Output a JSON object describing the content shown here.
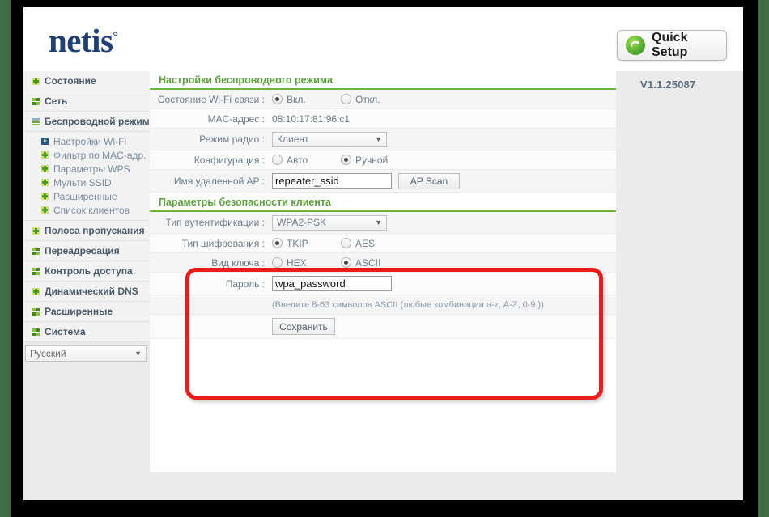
{
  "brand": {
    "logo_text": "netis",
    "logo_mark": "°"
  },
  "header": {
    "quick_setup_label": "Quick Setup",
    "quick_setup_icon": "refresh-circle-icon",
    "version": "V1.1.25087"
  },
  "sidebar": {
    "items": [
      {
        "label": "Состояние",
        "icon": "plus-square-icon",
        "level": "top",
        "active": false
      },
      {
        "label": "Сеть",
        "icon": "grid-square-icon",
        "level": "top",
        "active": false
      },
      {
        "label": "Беспроводной режим",
        "icon": "bars-square-icon",
        "level": "top",
        "active": true
      },
      {
        "label": "Настройки Wi-Fi",
        "icon": "arrow-square-icon",
        "level": "sub",
        "active": true
      },
      {
        "label": "Фильтр по MAC-адр.",
        "icon": "plus-square-icon",
        "level": "sub",
        "active": false
      },
      {
        "label": "Параметры WPS",
        "icon": "plus-square-icon",
        "level": "sub",
        "active": false
      },
      {
        "label": "Мульти SSID",
        "icon": "plus-square-icon",
        "level": "sub",
        "active": false
      },
      {
        "label": "Расширенные",
        "icon": "plus-square-icon",
        "level": "sub",
        "active": false
      },
      {
        "label": "Список клиентов",
        "icon": "plus-square-icon",
        "level": "sub",
        "active": false
      },
      {
        "label": "Полоса пропускания",
        "icon": "plus-square-icon",
        "level": "top",
        "active": false
      },
      {
        "label": "Переадресация",
        "icon": "grid-square-icon",
        "level": "top",
        "active": false
      },
      {
        "label": "Контроль доступа",
        "icon": "grid-square-icon",
        "level": "top",
        "active": false
      },
      {
        "label": "Динамический DNS",
        "icon": "plus-square-icon",
        "level": "top",
        "active": false
      },
      {
        "label": "Расширенные",
        "icon": "grid-square-icon",
        "level": "top",
        "active": false
      },
      {
        "label": "Система",
        "icon": "grid-square-icon",
        "level": "top",
        "active": false
      }
    ],
    "language_select": {
      "value": "Русский",
      "arrow": "▼"
    }
  },
  "wireless_section": {
    "title": "Настройки беспроводного режима",
    "wifi_state": {
      "label": "Состояние Wi-Fi связи :",
      "option_on": "Вкл.",
      "option_off": "Откл.",
      "selected": "on"
    },
    "mac_address": {
      "label": "MAC-адрес :",
      "value": "08:10:17:81:96:c1"
    },
    "radio_mode": {
      "label": "Режим радио :",
      "value": "Клиент",
      "arrow": "▼"
    },
    "configuration": {
      "label": "Конфигурация :",
      "option_auto": "Авто",
      "option_manual": "Ручной",
      "selected": "manual"
    },
    "remote_ap": {
      "label": "Имя удаленной AP :",
      "value": "repeater_ssid",
      "placeholder": "",
      "scan_button": "AP Scan"
    }
  },
  "security_section": {
    "title": "Параметры безопасности клиента",
    "auth_type": {
      "label": "Тип аутентификации :",
      "value": "WPA2-PSK",
      "arrow": "▼"
    },
    "encryption_type": {
      "label": "Тип шифрования :",
      "option_tkip": "TKIP",
      "option_aes": "AES",
      "selected": "tkip"
    },
    "key_type": {
      "label": "Вид ключа :",
      "option_hex": "HEX",
      "option_ascii": "ASCII",
      "selected": "ascii"
    },
    "password": {
      "label": "Пароль :",
      "value": "wpa_password",
      "placeholder": ""
    },
    "hint": "(Введите 8-63 символов ASCII (любые комбинации a-z, A-Z, 0-9.))",
    "save_button": "Сохранить"
  },
  "annotation": {
    "highlight_color": "#ed1c1c",
    "shape": "rounded-rectangle"
  },
  "colors": {
    "brand_blue": "#1f3f77",
    "section_green": "#5aa13b",
    "label_gray": "#6d7b88",
    "page_bg": "#ebebeb",
    "outer_green": "#3f6b45"
  }
}
